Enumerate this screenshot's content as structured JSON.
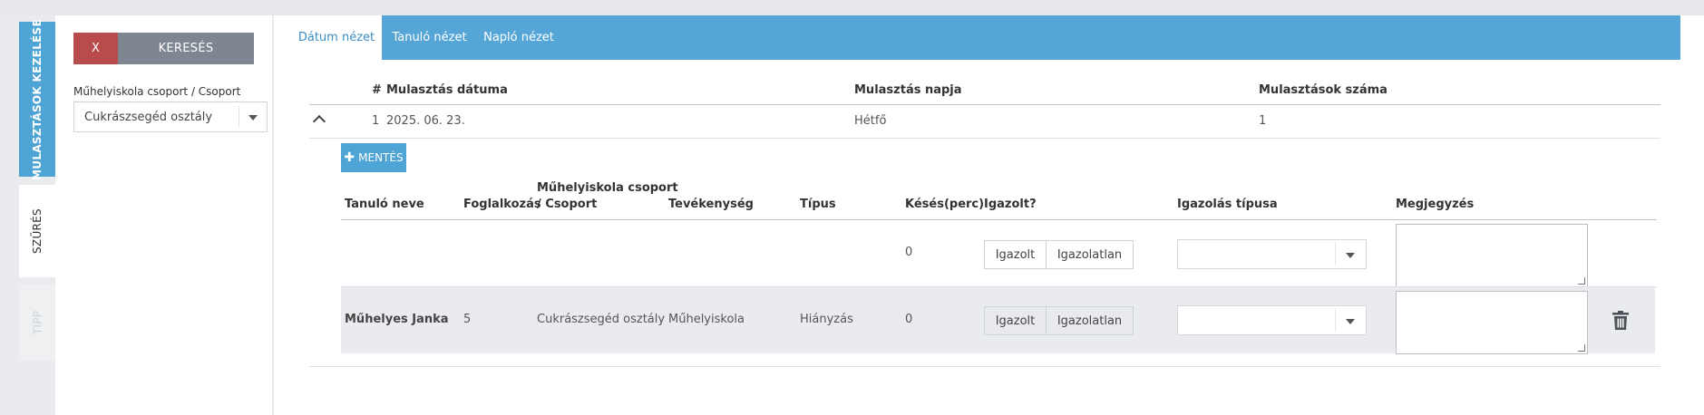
{
  "side_tabs": {
    "management": "MULASZTÁSOK KEZELÉSE",
    "filter": "SZŰRÉS",
    "tip": "TIPP"
  },
  "filter": {
    "clear_label": "X",
    "search_label": "KERESÉS",
    "group_label": "Műhelyiskola csoport / Csoport",
    "group_value": "Cukrászsegéd osztály"
  },
  "tabs": [
    {
      "label": "Dátum nézet",
      "active": true
    },
    {
      "label": "Tanuló nézet",
      "active": false
    },
    {
      "label": "Napló nézet",
      "active": false
    }
  ],
  "summary_table": {
    "headers": {
      "num": "#",
      "date": "Mulasztás dátuma",
      "day": "Mulasztás napja",
      "count": "Mulasztások száma"
    },
    "rows": [
      {
        "num": "1",
        "date": "2025. 06. 23.",
        "day": "Hétfő",
        "count": "1"
      }
    ]
  },
  "save_label": "MENTÉS",
  "detail_table": {
    "headers": {
      "student": "Tanuló neve",
      "lesson": "Foglalkozás",
      "group_line1": "Műhelyiskola csoport",
      "group_line2": "/ Csoport",
      "activity": "Tevékenység",
      "type": "Típus",
      "late": "Késés(perc)",
      "justified": "Igazolt?",
      "justification_type": "Igazolás típusa",
      "note": "Megjegyzés"
    },
    "bulk_row": {
      "late": "0",
      "justified_label": "Igazolt",
      "unjustified_label": "Igazolatlan"
    },
    "rows": [
      {
        "student": "Műhelyes Janka",
        "lesson": "5",
        "group": "Cukrászsegéd osztály",
        "activity": "Műhelyiskola",
        "type": "Hiányzás",
        "late": "0",
        "justified_label": "Igazolt",
        "unjustified_label": "Igazolatlan"
      }
    ]
  },
  "colors": {
    "accent": "#55a5d6",
    "danger": "#b84b4b",
    "neutral_button": "#7e8791"
  },
  "icons": [
    "chevron-up-icon",
    "plus-icon",
    "chevron-down-icon",
    "trash-icon"
  ]
}
